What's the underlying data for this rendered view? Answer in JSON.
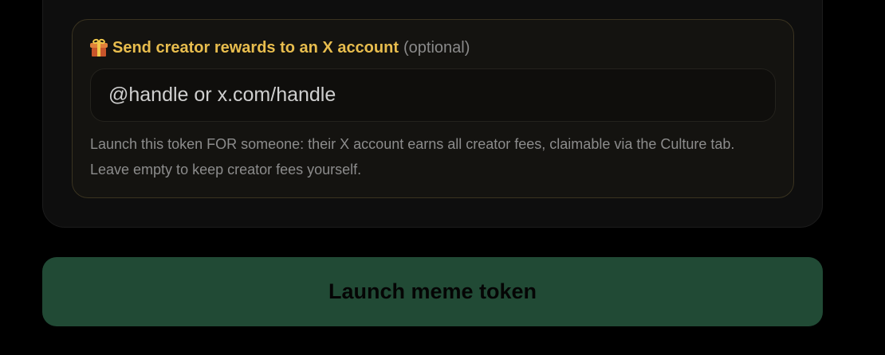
{
  "rewards": {
    "icon": "gift-icon",
    "title": "Send creator rewards to an X account",
    "optional_label": "(optional)",
    "input_placeholder": "@handle or x.com/handle",
    "input_value": "",
    "help_text": "Launch this token FOR someone: their X account earns all creator fees, claimable via the Culture tab. Leave empty to keep creator fees yourself."
  },
  "actions": {
    "launch_label": "Launch meme token"
  },
  "colors": {
    "accent_gold": "#e8bd4e",
    "button_green": "#214a35",
    "background": "#000000"
  }
}
